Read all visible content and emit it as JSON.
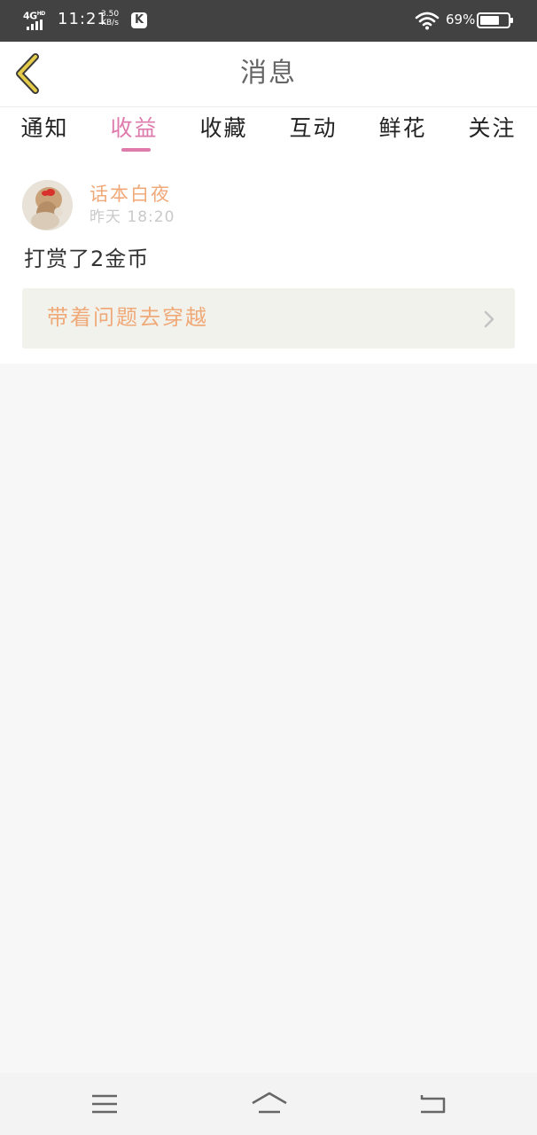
{
  "status_bar": {
    "network": "4G",
    "network_sup": "HD",
    "time": "11:21",
    "speed_value": "3.50",
    "speed_unit": "KB/s",
    "app_icon_letter": "K",
    "battery_percent": "69%",
    "battery_level": 0.69,
    "icons": [
      "signal-icon",
      "app-k-icon",
      "wifi-icon",
      "battery-icon"
    ]
  },
  "header": {
    "title": "消息",
    "back_icon": "chevron-left-icon",
    "accent_color": "#e4cc4a"
  },
  "tabs": [
    {
      "label": "通知",
      "active": false
    },
    {
      "label": "收益",
      "active": true
    },
    {
      "label": "收藏",
      "active": false
    },
    {
      "label": "互动",
      "active": false
    },
    {
      "label": "鲜花",
      "active": false
    },
    {
      "label": "关注",
      "active": false
    }
  ],
  "colors": {
    "active_tab": "#de7aac",
    "name_and_link": "#f0a978",
    "page_background": "#f8f7f7"
  },
  "messages": [
    {
      "sender": "话本白夜",
      "time": "昨天 18:20",
      "content": "打赏了2金币",
      "book_title": "带着问题去穿越",
      "link_icon": "chevron-right-icon"
    }
  ],
  "nav_bar": {
    "icons": [
      "menu-icon",
      "home-icon",
      "back-icon"
    ]
  }
}
